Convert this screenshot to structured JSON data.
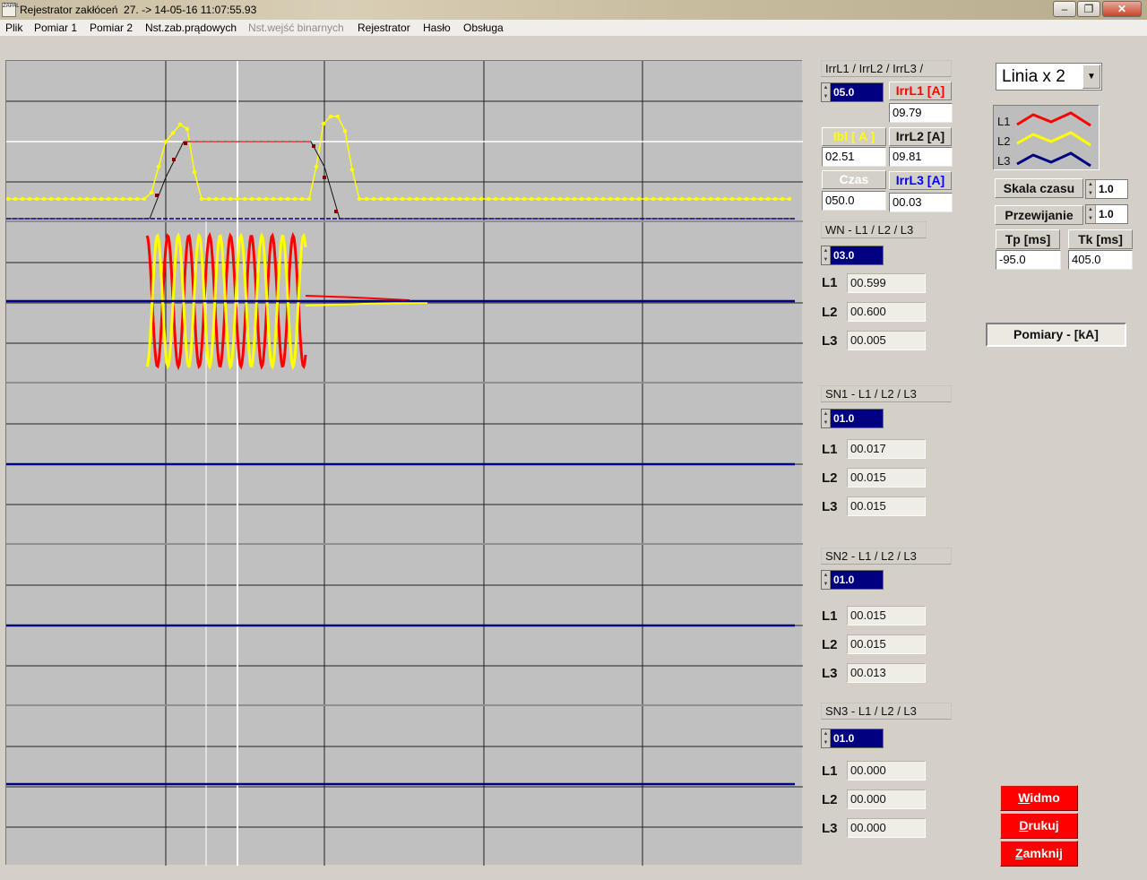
{
  "window": {
    "title": "Rejestrator zakłóceń  27. -> 14-05-16 11:07:55.93",
    "icon_label": "ZAPAL",
    "minimize": "–",
    "restore": "❐",
    "close": "✕"
  },
  "menu": [
    "Plik",
    "Pomiar 1",
    "Pomiar 2",
    "Nst.zab.prądowych",
    "Nst.wejść binarnych",
    "Rejestrator",
    "Hasło",
    "Obsługa"
  ],
  "irr": {
    "header": "IrrL1 / IrrL2 / IrrL3 /",
    "scale": "05.0",
    "irrl1_label": "IrrL1 [A]",
    "irrl1_value": "09.79",
    "ibl_label": "Ibl [ A ]",
    "ibl_value": "02.51",
    "irrl2_label": "IrrL2 [A]",
    "irrl2_value": "09.81",
    "czas_label": "Czas",
    "czas_value": "050.0",
    "irrl3_label": "IrrL3 [A]",
    "irrl3_value": "00.03"
  },
  "wn": {
    "header": "WN - L1 / L2 / L3",
    "scale": "03.0",
    "l1": "00.599",
    "l2": "00.600",
    "l3": "00.005"
  },
  "sn1": {
    "header": "SN1 - L1 / L2 / L3",
    "scale": "01.0",
    "l1": "00.017",
    "l2": "00.015",
    "l3": "00.015"
  },
  "sn2": {
    "header": "SN2 - L1 / L2 / L3",
    "scale": "01.0",
    "l1": "00.015",
    "l2": "00.015",
    "l3": "00.013"
  },
  "sn3": {
    "header": "SN3 - L1 / L2 / L3",
    "scale": "01.0",
    "l1": "00.000",
    "l2": "00.000",
    "l3": "00.000"
  },
  "row_labels": {
    "l1": "L1",
    "l2": "L2",
    "l3": "L3"
  },
  "linia": {
    "value": "Linia x 2",
    "drop_icon": "▼"
  },
  "legend": {
    "l1": "L1",
    "l2": "L2",
    "l3": "L3",
    "colors": {
      "l1": "#ff0000",
      "l2": "#ffff00",
      "l3": "#000080"
    }
  },
  "skala_czasu": {
    "label": "Skala czasu",
    "value": "1.0"
  },
  "przewijanie": {
    "label": "Przewijanie",
    "value": "1.0"
  },
  "tp": {
    "label": "Tp [ms]",
    "value": "-95.0"
  },
  "tk": {
    "label": "Tk [ms]",
    "value": "405.0"
  },
  "pomiary": "Pomiary - [kA]",
  "buttons": {
    "widmo_first": "W",
    "widmo_rest": "idmo",
    "drukuj_first": "D",
    "drukuj_rest": "rukuj",
    "zamknij_first": "Z",
    "zamknij_rest": "amknij"
  },
  "colors": {
    "accent_blue": "#000080",
    "button_red": "#ff0000",
    "plot_bg": "#c0c0c0"
  }
}
